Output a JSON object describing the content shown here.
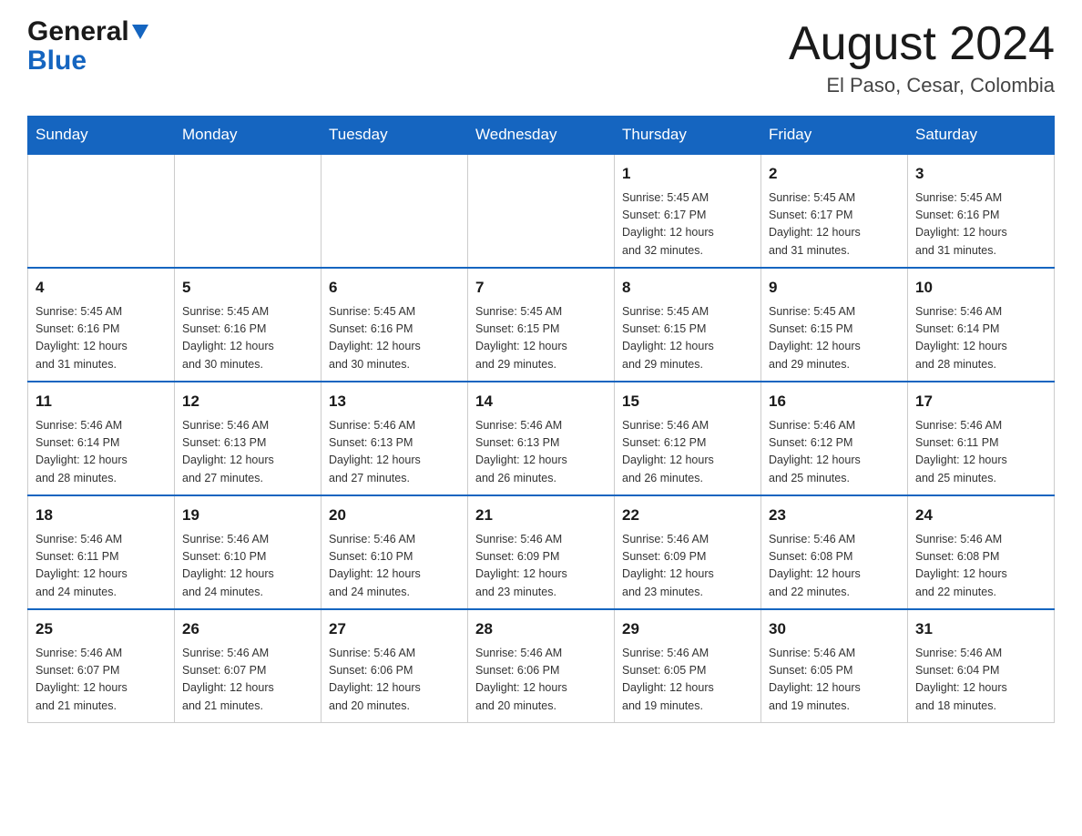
{
  "header": {
    "logo_general": "General",
    "logo_blue": "Blue",
    "month_title": "August 2024",
    "location": "El Paso, Cesar, Colombia"
  },
  "days_of_week": [
    "Sunday",
    "Monday",
    "Tuesday",
    "Wednesday",
    "Thursday",
    "Friday",
    "Saturday"
  ],
  "weeks": [
    [
      {
        "num": "",
        "info": ""
      },
      {
        "num": "",
        "info": ""
      },
      {
        "num": "",
        "info": ""
      },
      {
        "num": "",
        "info": ""
      },
      {
        "num": "1",
        "info": "Sunrise: 5:45 AM\nSunset: 6:17 PM\nDaylight: 12 hours\nand 32 minutes."
      },
      {
        "num": "2",
        "info": "Sunrise: 5:45 AM\nSunset: 6:17 PM\nDaylight: 12 hours\nand 31 minutes."
      },
      {
        "num": "3",
        "info": "Sunrise: 5:45 AM\nSunset: 6:16 PM\nDaylight: 12 hours\nand 31 minutes."
      }
    ],
    [
      {
        "num": "4",
        "info": "Sunrise: 5:45 AM\nSunset: 6:16 PM\nDaylight: 12 hours\nand 31 minutes."
      },
      {
        "num": "5",
        "info": "Sunrise: 5:45 AM\nSunset: 6:16 PM\nDaylight: 12 hours\nand 30 minutes."
      },
      {
        "num": "6",
        "info": "Sunrise: 5:45 AM\nSunset: 6:16 PM\nDaylight: 12 hours\nand 30 minutes."
      },
      {
        "num": "7",
        "info": "Sunrise: 5:45 AM\nSunset: 6:15 PM\nDaylight: 12 hours\nand 29 minutes."
      },
      {
        "num": "8",
        "info": "Sunrise: 5:45 AM\nSunset: 6:15 PM\nDaylight: 12 hours\nand 29 minutes."
      },
      {
        "num": "9",
        "info": "Sunrise: 5:45 AM\nSunset: 6:15 PM\nDaylight: 12 hours\nand 29 minutes."
      },
      {
        "num": "10",
        "info": "Sunrise: 5:46 AM\nSunset: 6:14 PM\nDaylight: 12 hours\nand 28 minutes."
      }
    ],
    [
      {
        "num": "11",
        "info": "Sunrise: 5:46 AM\nSunset: 6:14 PM\nDaylight: 12 hours\nand 28 minutes."
      },
      {
        "num": "12",
        "info": "Sunrise: 5:46 AM\nSunset: 6:13 PM\nDaylight: 12 hours\nand 27 minutes."
      },
      {
        "num": "13",
        "info": "Sunrise: 5:46 AM\nSunset: 6:13 PM\nDaylight: 12 hours\nand 27 minutes."
      },
      {
        "num": "14",
        "info": "Sunrise: 5:46 AM\nSunset: 6:13 PM\nDaylight: 12 hours\nand 26 minutes."
      },
      {
        "num": "15",
        "info": "Sunrise: 5:46 AM\nSunset: 6:12 PM\nDaylight: 12 hours\nand 26 minutes."
      },
      {
        "num": "16",
        "info": "Sunrise: 5:46 AM\nSunset: 6:12 PM\nDaylight: 12 hours\nand 25 minutes."
      },
      {
        "num": "17",
        "info": "Sunrise: 5:46 AM\nSunset: 6:11 PM\nDaylight: 12 hours\nand 25 minutes."
      }
    ],
    [
      {
        "num": "18",
        "info": "Sunrise: 5:46 AM\nSunset: 6:11 PM\nDaylight: 12 hours\nand 24 minutes."
      },
      {
        "num": "19",
        "info": "Sunrise: 5:46 AM\nSunset: 6:10 PM\nDaylight: 12 hours\nand 24 minutes."
      },
      {
        "num": "20",
        "info": "Sunrise: 5:46 AM\nSunset: 6:10 PM\nDaylight: 12 hours\nand 24 minutes."
      },
      {
        "num": "21",
        "info": "Sunrise: 5:46 AM\nSunset: 6:09 PM\nDaylight: 12 hours\nand 23 minutes."
      },
      {
        "num": "22",
        "info": "Sunrise: 5:46 AM\nSunset: 6:09 PM\nDaylight: 12 hours\nand 23 minutes."
      },
      {
        "num": "23",
        "info": "Sunrise: 5:46 AM\nSunset: 6:08 PM\nDaylight: 12 hours\nand 22 minutes."
      },
      {
        "num": "24",
        "info": "Sunrise: 5:46 AM\nSunset: 6:08 PM\nDaylight: 12 hours\nand 22 minutes."
      }
    ],
    [
      {
        "num": "25",
        "info": "Sunrise: 5:46 AM\nSunset: 6:07 PM\nDaylight: 12 hours\nand 21 minutes."
      },
      {
        "num": "26",
        "info": "Sunrise: 5:46 AM\nSunset: 6:07 PM\nDaylight: 12 hours\nand 21 minutes."
      },
      {
        "num": "27",
        "info": "Sunrise: 5:46 AM\nSunset: 6:06 PM\nDaylight: 12 hours\nand 20 minutes."
      },
      {
        "num": "28",
        "info": "Sunrise: 5:46 AM\nSunset: 6:06 PM\nDaylight: 12 hours\nand 20 minutes."
      },
      {
        "num": "29",
        "info": "Sunrise: 5:46 AM\nSunset: 6:05 PM\nDaylight: 12 hours\nand 19 minutes."
      },
      {
        "num": "30",
        "info": "Sunrise: 5:46 AM\nSunset: 6:05 PM\nDaylight: 12 hours\nand 19 minutes."
      },
      {
        "num": "31",
        "info": "Sunrise: 5:46 AM\nSunset: 6:04 PM\nDaylight: 12 hours\nand 18 minutes."
      }
    ]
  ]
}
